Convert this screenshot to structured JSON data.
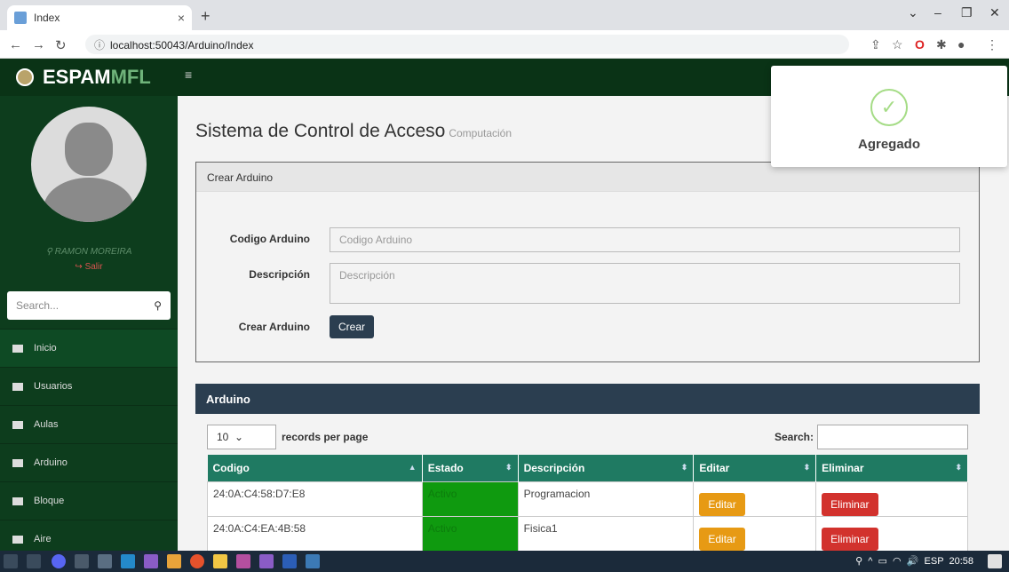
{
  "browser": {
    "tab_title": "Index",
    "url": "localhost:50043/Arduino/Index"
  },
  "sidebar": {
    "brand_a": "ESPAM",
    "brand_b": "MFL",
    "user": "RAMON MOREIRA",
    "logout": "Salir",
    "search_placeholder": "Search...",
    "items": [
      {
        "label": "Inicio"
      },
      {
        "label": "Usuarios"
      },
      {
        "label": "Aulas"
      },
      {
        "label": "Arduino"
      },
      {
        "label": "Bloque"
      },
      {
        "label": "Aire"
      }
    ]
  },
  "page": {
    "title": "Sistema de Control de Acceso",
    "subtitle": "Computación"
  },
  "form": {
    "panel_title": "Crear Arduino",
    "codigo_label": "Codigo Arduino",
    "codigo_placeholder": "Codigo Arduino",
    "desc_label": "Descripción",
    "desc_placeholder": "Descripción",
    "create_label": "Crear Arduino",
    "create_button": "Crear"
  },
  "table_panel": {
    "title": "Arduino",
    "page_len": "10",
    "records_label": "records per page",
    "search_label": "Search:",
    "headers": [
      "Codigo",
      "Estado",
      "Descripción",
      "Editar",
      "Eliminar"
    ],
    "rows": [
      {
        "codigo": "24:0A:C4:58:D7:E8",
        "estado": "Activo",
        "descripcion": "Programacion",
        "editar": "Editar",
        "eliminar": "Eliminar"
      },
      {
        "codigo": "24:0A:C4:EA:4B:58",
        "estado": "Activo",
        "descripcion": "Fisica1",
        "editar": "Editar",
        "eliminar": "Eliminar"
      }
    ]
  },
  "toast": {
    "message": "Agregado"
  },
  "taskbar": {
    "lang": "ESP",
    "time": "20:58"
  }
}
